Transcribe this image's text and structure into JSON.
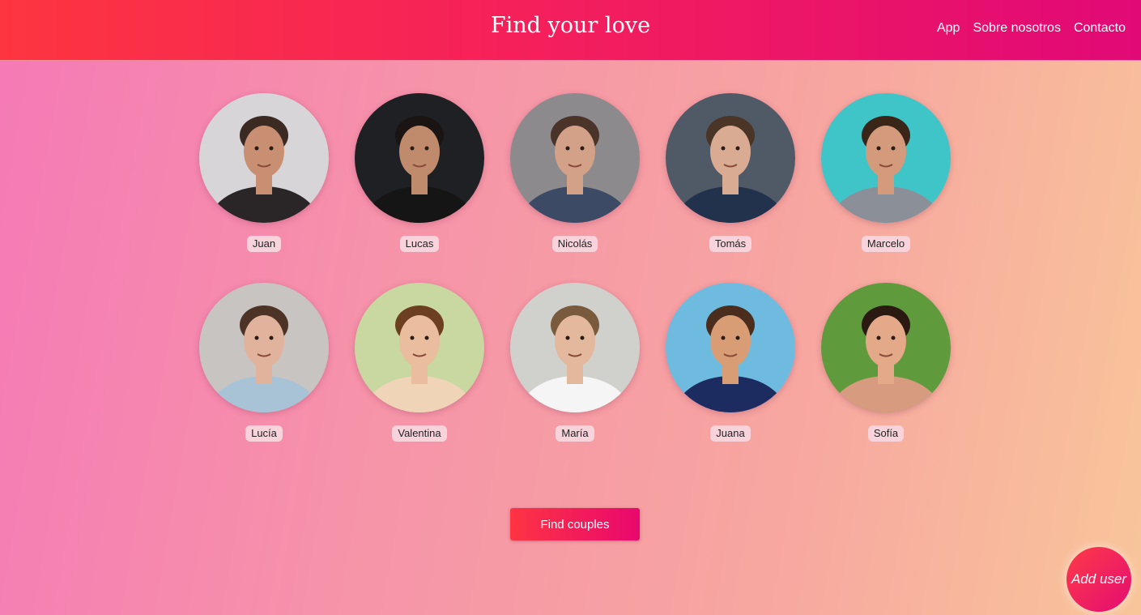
{
  "header": {
    "title": "Find your love",
    "nav": [
      "App",
      "Sobre nosotros",
      "Contacto"
    ]
  },
  "profiles": [
    {
      "name": "Juan",
      "bg": "#d8d5d8",
      "skin": "#c98f72",
      "hair": "#3a2a22",
      "cloth": "#2a2527"
    },
    {
      "name": "Lucas",
      "bg": "#1e2024",
      "skin": "#c08a6c",
      "hair": "#1a1412",
      "cloth": "#151515"
    },
    {
      "name": "Nicolás",
      "bg": "#8d8a8d",
      "skin": "#d3a088",
      "hair": "#4a3328",
      "cloth": "#3d4a66"
    },
    {
      "name": "Tomás",
      "bg": "#505a66",
      "skin": "#d8ab92",
      "hair": "#4b3526",
      "cloth": "#22324d"
    },
    {
      "name": "Marcelo",
      "bg": "#3fc5c8",
      "skin": "#d49a7c",
      "hair": "#3a2619",
      "cloth": "#8a8f98"
    },
    {
      "name": "Lucía",
      "bg": "#c8c4c2",
      "skin": "#e2b39c",
      "hair": "#4d3325",
      "cloth": "#a8c2d6"
    },
    {
      "name": "Valentina",
      "bg": "#c9d7a0",
      "skin": "#eabd9e",
      "hair": "#6b3f1f",
      "cloth": "#f0d4b8"
    },
    {
      "name": "María",
      "bg": "#d0d0cc",
      "skin": "#e3b89d",
      "hair": "#7a5a3c",
      "cloth": "#f5f5f5"
    },
    {
      "name": "Juana",
      "bg": "#6fbbe0",
      "skin": "#d99d76",
      "hair": "#4a2d1c",
      "cloth": "#1d2c60"
    },
    {
      "name": "Sofía",
      "bg": "#5f9a3d",
      "skin": "#e3a989",
      "hair": "#2a1a12",
      "cloth": "#d79c80"
    }
  ],
  "actions": {
    "find_label": "Find couples",
    "add_label": "Add user"
  }
}
